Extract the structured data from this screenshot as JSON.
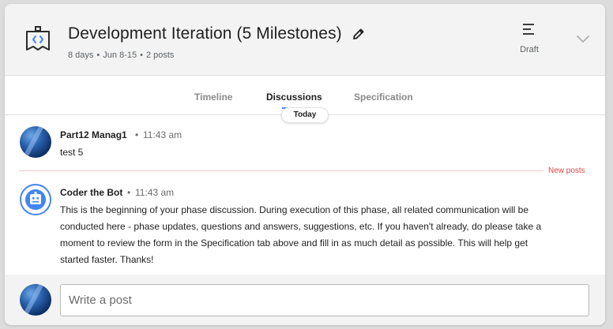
{
  "header": {
    "icon": "code-flag-icon",
    "title": "Development Iteration (5 Milestones)",
    "meta": {
      "duration": "8 days",
      "dates": "Jun 8-15",
      "posts": "2 posts",
      "separator": "•"
    },
    "status_icon": "lines-icon",
    "status_label": "Draft",
    "collapse_icon": "chevron-down-icon"
  },
  "tabs": [
    {
      "label": "Timeline",
      "active": false
    },
    {
      "label": "Discussions",
      "active": true
    },
    {
      "label": "Specification",
      "active": false
    }
  ],
  "today_label": "Today",
  "messages": [
    {
      "author": "Part12 Manag1",
      "separator": "•",
      "time": "11:43 am",
      "text": "test 5"
    },
    {
      "author": "Coder the Bot",
      "separator": "•",
      "time": "11:43 am",
      "lines": [
        "This is the beginning of your phase discussion. During execution of this phase, all related communication will be",
        "conducted here - phase updates, questions and answers, suggestions, etc. If you haven't already, do please take a",
        "moment to review the form in the Specification tab above and fill in as much detail as possible. This will help get",
        "started faster. Thanks!"
      ]
    }
  ],
  "new_posts_label": "New posts",
  "composer": {
    "placeholder": "Write a post"
  },
  "colors": {
    "accent": "#4285f4",
    "new_posts": "#e04848",
    "header_bg": "#f3f3f3"
  }
}
